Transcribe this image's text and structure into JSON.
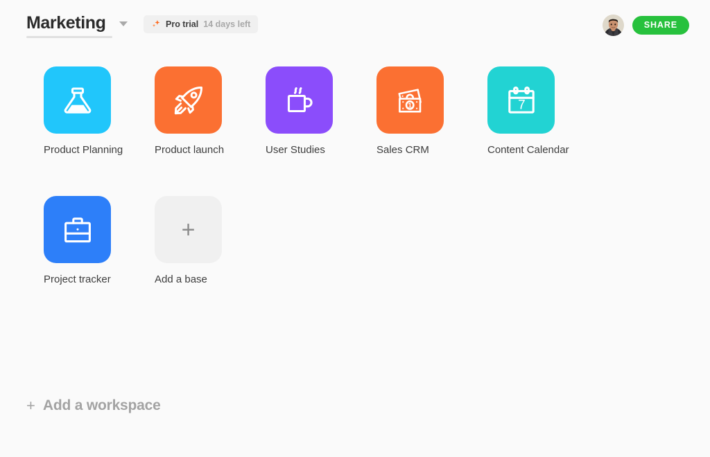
{
  "header": {
    "workspace_title": "Marketing",
    "workspace_caret_icon": "chevron-down-icon",
    "pro_badge": {
      "icon": "sparkle-icon",
      "label": "Pro trial",
      "days_left": "14 days left",
      "background": "#f0f0f0",
      "icon_color": "#ff6b1f"
    },
    "avatar_alt": "user-avatar",
    "share_label": "SHARE",
    "share_color": "#27c13d"
  },
  "bases": [
    {
      "name": "Product Planning",
      "icon": "flask-icon",
      "color": "#21c6fb"
    },
    {
      "name": "Product launch",
      "icon": "rocket-icon",
      "color": "#fb7032"
    },
    {
      "name": "User Studies",
      "icon": "coffee-cup-icon",
      "color": "#8b4dfb"
    },
    {
      "name": "Sales CRM",
      "icon": "banknotes-icon",
      "color": "#fb7032"
    },
    {
      "name": "Content Calendar",
      "icon": "calendar-icon",
      "color": "#22d3d3",
      "calendar_day": "7"
    },
    {
      "name": "Project tracker",
      "icon": "briefcase-icon",
      "color": "#2d7ff9"
    }
  ],
  "add_base": {
    "label": "Add a base",
    "icon": "plus-icon",
    "background": "#f0f0f0"
  },
  "add_workspace": {
    "label": "Add a workspace",
    "icon": "plus-icon"
  },
  "page": {
    "background": "#fafafa"
  }
}
